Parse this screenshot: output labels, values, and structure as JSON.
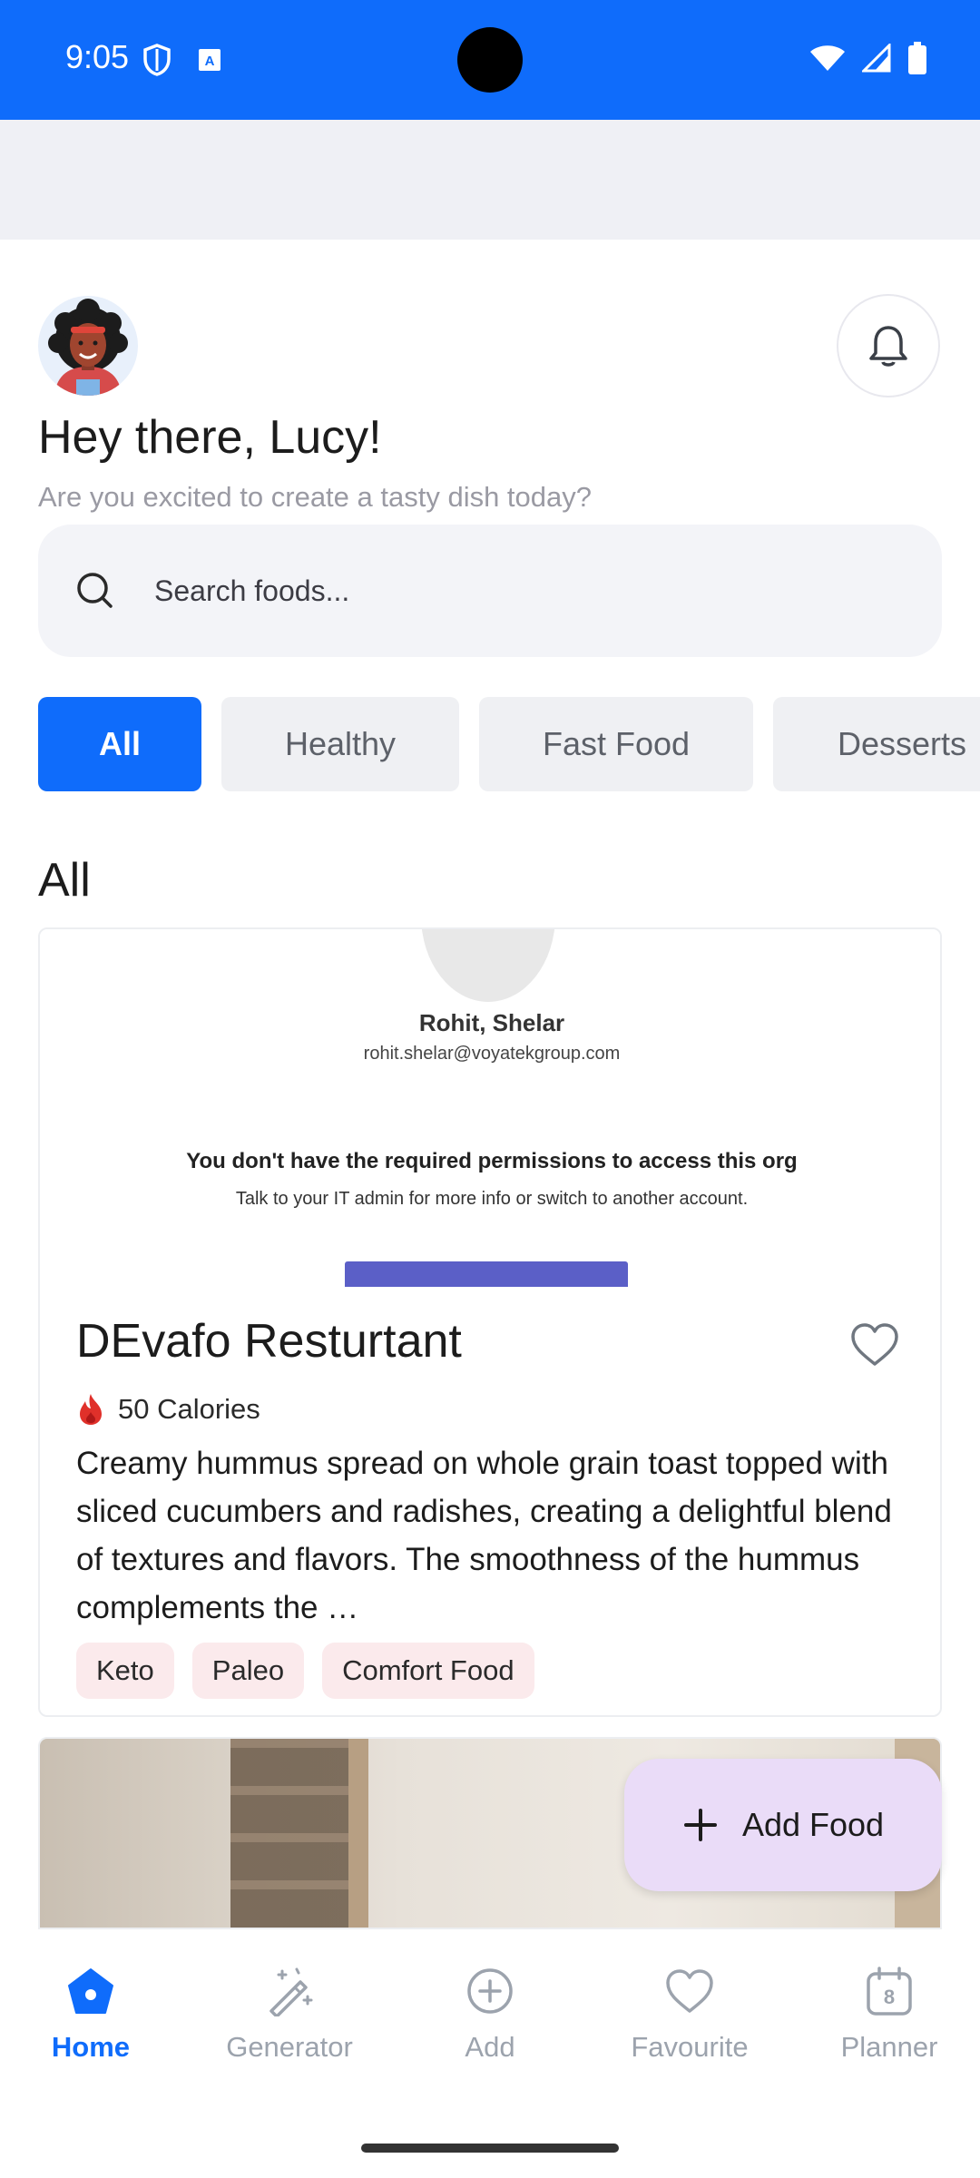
{
  "status_bar": {
    "time": "9:05"
  },
  "header": {
    "greeting": "Hey there, Lucy!",
    "subtitle": "Are you excited to create a tasty dish today?"
  },
  "search": {
    "placeholder": "Search foods..."
  },
  "categories": [
    {
      "label": "All",
      "active": true
    },
    {
      "label": "Healthy",
      "active": false
    },
    {
      "label": "Fast Food",
      "active": false
    },
    {
      "label": "Desserts",
      "active": false
    }
  ],
  "section_title": "All",
  "food_card": {
    "image_content": {
      "name": "Rohit, Shelar",
      "email": "rohit.shelar@voyatekgroup.com",
      "message": "You don't have the required permissions to access this org",
      "submessage": "Talk to your IT admin for more info or switch to another account."
    },
    "title": "DEvafo Resturtant",
    "calories": "50 Calories",
    "description": "Creamy hummus spread on whole grain toast topped with sliced cucumbers and radishes, creating a delightful blend of textures and flavors. The smoothness of the hummus complements the …",
    "tags": [
      "Keto",
      "Paleo",
      "Comfort Food"
    ]
  },
  "fab": {
    "label": "Add Food"
  },
  "bottom_nav": [
    {
      "label": "Home",
      "icon": "home-icon",
      "active": true
    },
    {
      "label": "Generator",
      "icon": "magic-wand-icon",
      "active": false
    },
    {
      "label": "Add",
      "icon": "add-circle-icon",
      "active": false
    },
    {
      "label": "Favourite",
      "icon": "heart-icon",
      "active": false
    },
    {
      "label": "Planner",
      "icon": "calendar-icon",
      "active": false,
      "badge": "8"
    }
  ],
  "colors": {
    "primary": "#0f6cfb",
    "fab_bg": "#eadcf8",
    "tag_bg": "#fbeaec"
  }
}
